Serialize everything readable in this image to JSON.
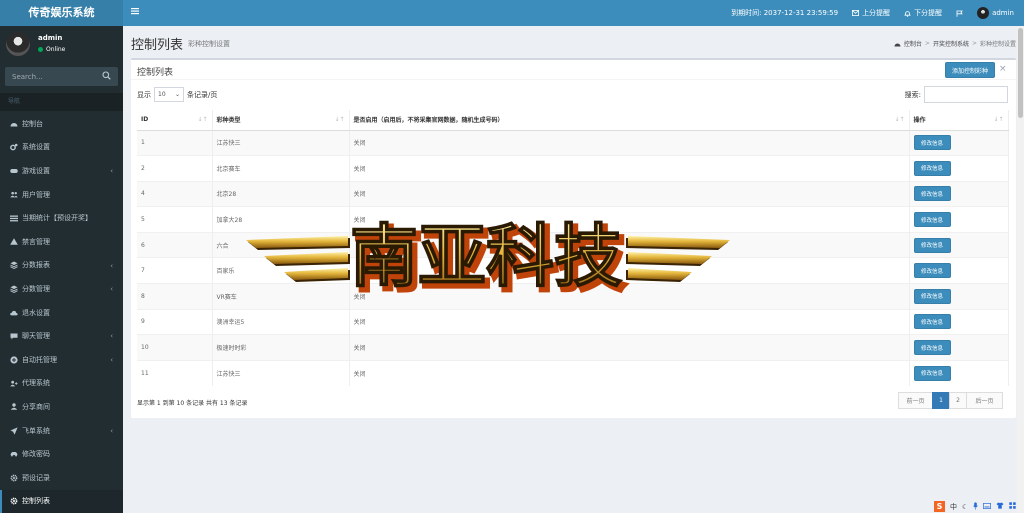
{
  "app": {
    "title": "传奇娱乐系统"
  },
  "header": {
    "expire_label": "到期时间: 2037-12-31 23:59:59",
    "up_score": "上分提醒",
    "down_score": "下分提醒",
    "user": "admin"
  },
  "sidebar": {
    "user_name": "admin",
    "status": "Online",
    "search_placeholder": "Search...",
    "nav_header": "导航",
    "items": [
      {
        "label": "控制台",
        "icon": "dashboard-icon",
        "chevron": false
      },
      {
        "label": "系统设置",
        "icon": "cogs-icon",
        "chevron": false
      },
      {
        "label": "游戏设置",
        "icon": "gamepad-icon",
        "chevron": true
      },
      {
        "label": "用户管理",
        "icon": "users-icon",
        "chevron": false
      },
      {
        "label": "当期统计【预设开奖】",
        "icon": "list-icon",
        "chevron": false
      },
      {
        "label": "禁言管理",
        "icon": "warning-icon",
        "chevron": false
      },
      {
        "label": "分数报表",
        "icon": "layers-icon",
        "chevron": true
      },
      {
        "label": "分数管理",
        "icon": "layers-icon",
        "chevron": true
      },
      {
        "label": "退水设置",
        "icon": "cloud-icon",
        "chevron": false
      },
      {
        "label": "聊天管理",
        "icon": "chat-icon",
        "chevron": true
      },
      {
        "label": "自动托管理",
        "icon": "plus-circle-icon",
        "chevron": true
      },
      {
        "label": "代理系统",
        "icon": "user-plus-icon",
        "chevron": false
      },
      {
        "label": "分享商间",
        "icon": "user-icon",
        "chevron": false
      },
      {
        "label": "飞单系统",
        "icon": "plane-icon",
        "chevron": true
      },
      {
        "label": "修改密码",
        "icon": "car-icon",
        "chevron": false
      },
      {
        "label": "预设记录",
        "icon": "gear-icon",
        "chevron": false
      },
      {
        "label": "控制列表",
        "icon": "gear-icon",
        "chevron": false,
        "active": true
      }
    ]
  },
  "page": {
    "title": "控制列表",
    "subtitle": "彩种控制设置",
    "breadcrumb": [
      "控制台",
      "开奖控制系统",
      "彩种控制设置"
    ]
  },
  "box": {
    "title": "控制列表",
    "add_button": "添加控制彩种",
    "length_prefix": "显示",
    "length_value": "10",
    "length_suffix": "条记录/页",
    "search_label": "搜索:",
    "columns": [
      "ID",
      "彩种类型",
      "是否启用（启用后，不将采集官网数据，随机生成号码）",
      "操作"
    ],
    "rows": [
      {
        "id": "1",
        "type": "江苏快三",
        "enabled": "关闭",
        "action": "修改信息"
      },
      {
        "id": "2",
        "type": "北京赛车",
        "enabled": "关闭",
        "action": "修改信息"
      },
      {
        "id": "4",
        "type": "北京28",
        "enabled": "关闭",
        "action": "修改信息"
      },
      {
        "id": "5",
        "type": "加拿大28",
        "enabled": "关闭",
        "action": "修改信息"
      },
      {
        "id": "6",
        "type": "六合",
        "enabled": "",
        "action": "修改信息"
      },
      {
        "id": "7",
        "type": "百家乐",
        "enabled": "",
        "action": "修改信息"
      },
      {
        "id": "8",
        "type": "VR赛车",
        "enabled": "关闭",
        "action": "修改信息"
      },
      {
        "id": "9",
        "type": "澳洲幸运5",
        "enabled": "关闭",
        "action": "修改信息"
      },
      {
        "id": "10",
        "type": "极速时时彩",
        "enabled": "关闭",
        "action": "修改信息"
      },
      {
        "id": "11",
        "type": "江苏快三",
        "enabled": "关闭",
        "action": "修改信息"
      }
    ],
    "info": "显示第 1 到第 10 条记录 共有 13 条记录",
    "pager": {
      "prev": "前一页",
      "pages": [
        "1",
        "2"
      ],
      "current": "1",
      "next": "后一页"
    }
  },
  "watermark": {
    "text": "南亚科技"
  },
  "ime": {
    "logo": "S",
    "lang": "中"
  },
  "colors": {
    "header": "#3c8dbc",
    "logo_bg": "#367fa9",
    "sidebar": "#222d32",
    "primary": "#3c8dbc"
  }
}
